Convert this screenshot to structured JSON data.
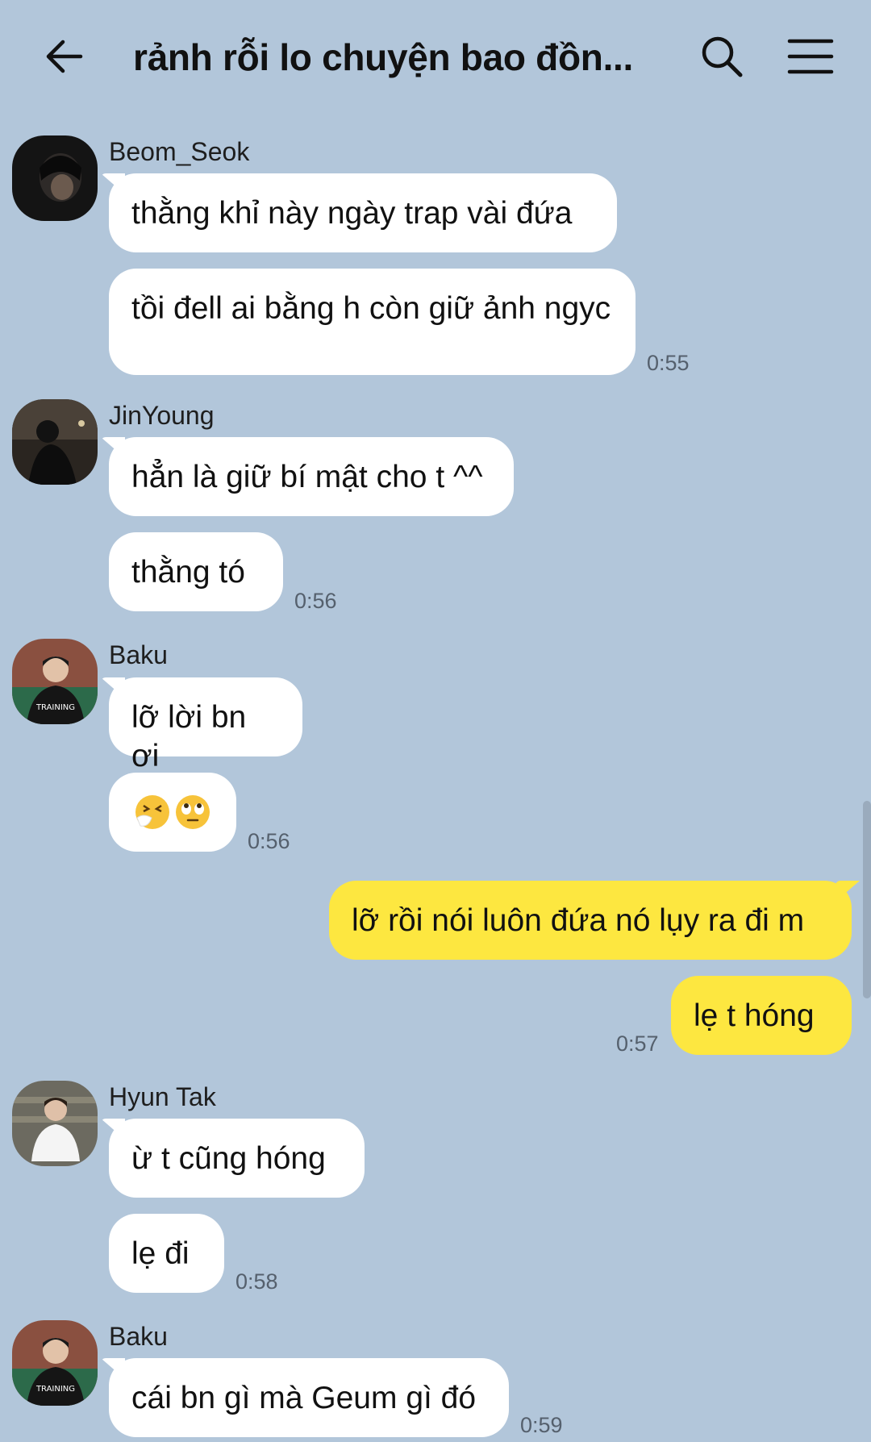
{
  "header": {
    "title": "rảnh rỗi lo chuyện bao đồn...",
    "back_icon": "arrow-left-icon",
    "search_icon": "search-icon",
    "menu_icon": "hamburger-menu-icon"
  },
  "messages": [
    {
      "sender": "Beom_Seok",
      "texts": [
        "thằng khỉ này ngày trap vài đứa",
        "tồi đell ai bằng h còn giữ ảnh ngyc"
      ],
      "time": "0:55"
    },
    {
      "sender": "JinYoung",
      "texts": [
        "hẳn là giữ bí mật cho t ^^",
        "thằng tó"
      ],
      "time": "0:56"
    },
    {
      "sender": "Baku",
      "texts": [
        "lỡ lời bn ơi",
        "sneezing-face-emoji rolling-eyes-emoji"
      ],
      "time": "0:56"
    },
    {
      "sender": "me",
      "texts": [
        "lỡ rồi nói luôn đứa nó lụy ra đi m",
        "lẹ t hóng"
      ],
      "time": "0:57"
    },
    {
      "sender": "Hyun Tak",
      "texts": [
        "ừ t cũng hóng",
        "lẹ đi"
      ],
      "time": "0:58"
    },
    {
      "sender": "Baku",
      "texts": [
        "cái bn gì mà Geum gì đó"
      ],
      "time": "0:59"
    }
  ],
  "colors": {
    "background": "#b2c6da",
    "my_bubble": "#fde740",
    "other_bubble": "#ffffff"
  }
}
